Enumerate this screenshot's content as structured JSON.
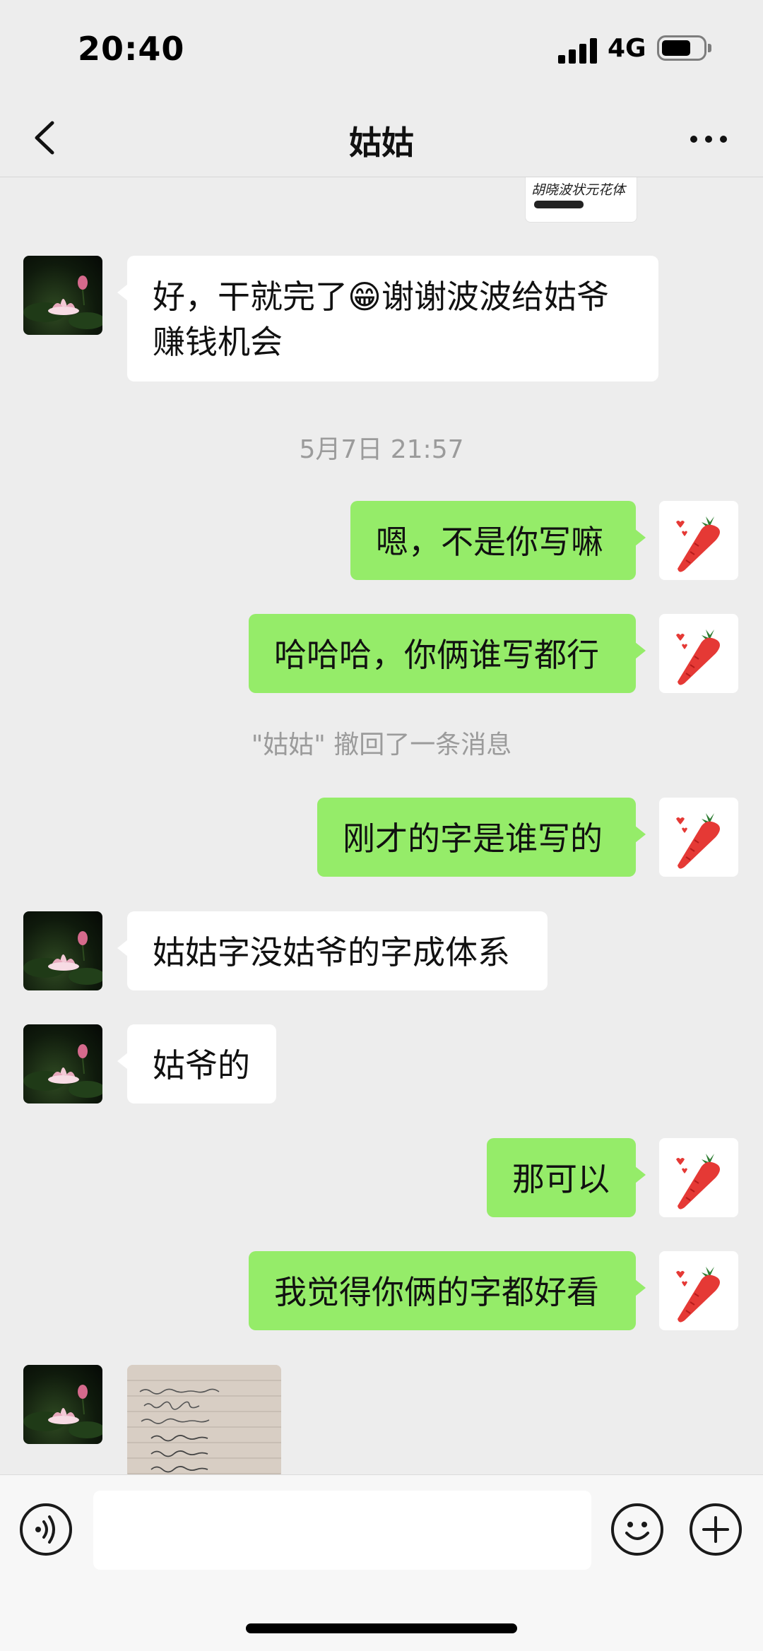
{
  "status_bar": {
    "time": "20:40",
    "network": "4G"
  },
  "nav": {
    "title": "姑姑"
  },
  "messages": {
    "top_image_caption": "胡晓波状元花体",
    "m1": "好，干就完了😁谢谢波波给姑爷赚钱机会",
    "timestamp": "5月7日 21:57",
    "m2": "嗯，不是你写嘛",
    "m3": "哈哈哈，你俩谁写都行",
    "recall_notice": "\"姑姑\" 撤回了一条消息",
    "m4": "刚才的字是谁写的",
    "m5": "姑姑字没姑爷的字成体系",
    "m6": "姑爷的",
    "m7": "那可以",
    "m8": "我觉得你俩的字都好看"
  },
  "input": {
    "placeholder": ""
  },
  "colors": {
    "background": "#ededed",
    "bubble_outgoing": "#95ec69",
    "bubble_incoming": "#ffffff",
    "system_text": "#9b9b9b"
  },
  "icons": {
    "back": "chevron-left-icon",
    "more": "more-dots-icon",
    "voice": "voice-icon",
    "emoji": "emoji-icon",
    "plus": "plus-icon"
  }
}
